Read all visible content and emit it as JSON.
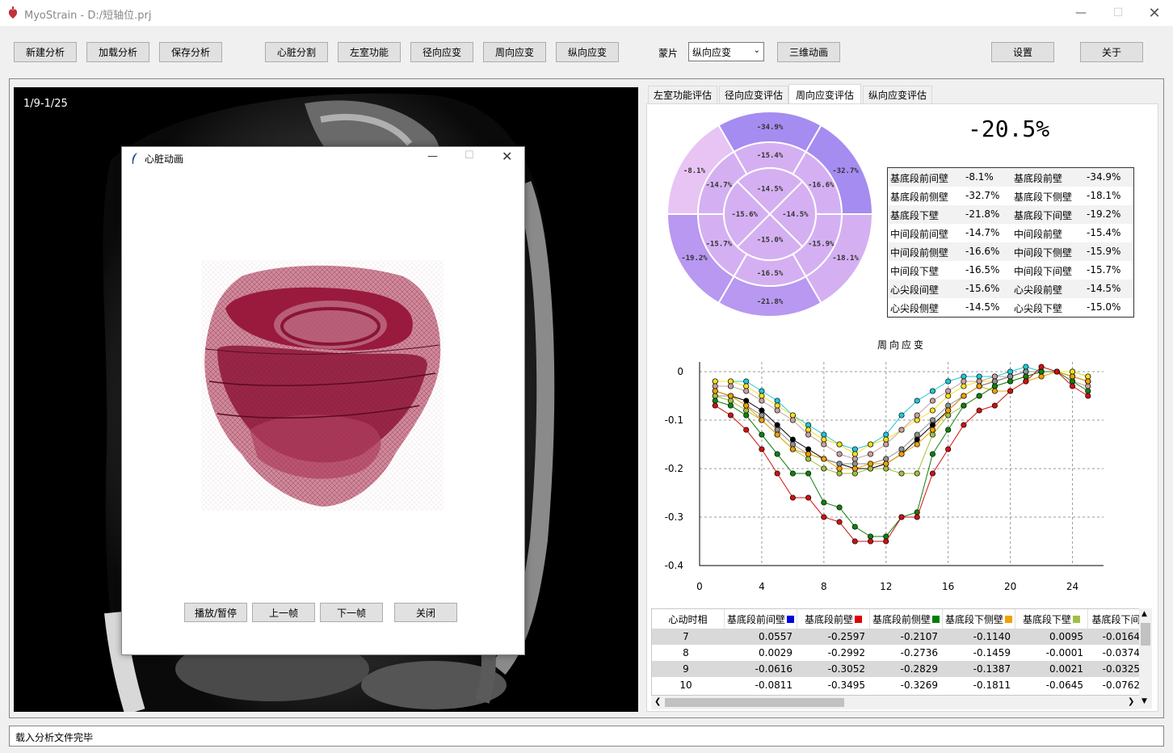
{
  "window": {
    "app_title": "MyoStrain - D:/短轴位.prj"
  },
  "toolbar": {
    "buttons": [
      "新建分析",
      "加载分析",
      "保存分析",
      "心脏分割",
      "左室功能",
      "径向应变",
      "周向应变",
      "纵向应变"
    ],
    "combo_label": "蒙片",
    "combo_value": "纵向应变",
    "anim_button": "三维动画",
    "settings_button": "设置",
    "about_button": "关于"
  },
  "viewer": {
    "frame_counter": "1/9-1/25"
  },
  "popup": {
    "title": "心脏动画",
    "buttons": [
      "播放/暂停",
      "上一帧",
      "下一帧",
      "关闭"
    ]
  },
  "tabs": [
    "左室功能评估",
    "径向应变评估",
    "周向应变评估",
    "纵向应变评估"
  ],
  "active_tab": 2,
  "global_strain": "-20.5%",
  "bullseye": {
    "outer": [
      "-34.9%",
      "-32.7%",
      "-18.1%",
      "-21.8%",
      "-19.2%",
      "-8.1%"
    ],
    "middle": [
      "-15.4%",
      "-16.6%",
      "-15.9%",
      "-16.5%",
      "-15.7%",
      "-14.7%"
    ],
    "inner": [
      "-14.5%",
      "-14.5%",
      "-15.0%",
      "-15.6%"
    ],
    "colors": {
      "light": "#e8c4f5",
      "mid": "#d4b0f2",
      "strong": "#b898f0",
      "strongest": "#a58cf0",
      "border": "#ffffff"
    }
  },
  "segment_table": [
    [
      "基底段前间壁",
      "-8.1%",
      "基底段前壁",
      "-34.9%"
    ],
    [
      "基底段前侧壁",
      "-32.7%",
      "基底段下侧壁",
      "-18.1%"
    ],
    [
      "基底段下壁",
      "-21.8%",
      "基底段下间壁",
      "-19.2%"
    ],
    [
      "中间段前间壁",
      "-14.7%",
      "中间段前壁",
      "-15.4%"
    ],
    [
      "中间段前侧壁",
      "-16.6%",
      "中间段下侧壁",
      "-15.9%"
    ],
    [
      "中间段下壁",
      "-16.5%",
      "中间段下间壁",
      "-15.7%"
    ],
    [
      "心尖段间壁",
      "-15.6%",
      "心尖段前壁",
      "-14.5%"
    ],
    [
      "心尖段侧壁",
      "-14.5%",
      "心尖段下壁",
      "-15.0%"
    ]
  ],
  "chart_data": {
    "type": "line",
    "title": "周向应变",
    "xlim": [
      0,
      26
    ],
    "ylim": [
      -0.4,
      0.02
    ],
    "x_ticks": [
      "0",
      "4",
      "8",
      "12",
      "16",
      "20",
      "24"
    ],
    "y_ticks": [
      "0",
      "-0.1",
      "-0.2",
      "-0.3",
      "-0.4"
    ],
    "grid": true,
    "x": [
      1,
      2,
      3,
      4,
      5,
      6,
      7,
      8,
      9,
      10,
      11,
      12,
      13,
      14,
      15,
      16,
      17,
      18,
      19,
      20,
      21,
      22,
      23,
      24,
      25
    ],
    "series": [
      {
        "color": "#1ec8d8",
        "values": [
          -0.02,
          -0.02,
          -0.02,
          -0.04,
          -0.06,
          -0.09,
          -0.11,
          -0.13,
          -0.15,
          -0.16,
          -0.15,
          -0.13,
          -0.09,
          -0.06,
          -0.04,
          -0.02,
          -0.01,
          -0.01,
          -0.01,
          0.0,
          0.01,
          0.0,
          0.0,
          0.0,
          -0.01
        ]
      },
      {
        "color": "#f5e020",
        "values": [
          -0.02,
          -0.02,
          -0.03,
          -0.05,
          -0.07,
          -0.09,
          -0.12,
          -0.14,
          -0.15,
          -0.17,
          -0.15,
          -0.14,
          -0.12,
          -0.1,
          -0.08,
          -0.05,
          -0.03,
          -0.02,
          -0.02,
          -0.01,
          0.0,
          0.0,
          0.0,
          0.0,
          -0.01
        ]
      },
      {
        "color": "#c8a0a0",
        "values": [
          -0.03,
          -0.03,
          -0.04,
          -0.06,
          -0.08,
          -0.1,
          -0.13,
          -0.15,
          -0.17,
          -0.18,
          -0.17,
          -0.15,
          -0.12,
          -0.09,
          -0.06,
          -0.04,
          -0.02,
          -0.02,
          -0.01,
          -0.01,
          0.0,
          0.0,
          0.0,
          -0.02,
          -0.03
        ]
      },
      {
        "color": "#000000",
        "values": [
          -0.04,
          -0.05,
          -0.06,
          -0.08,
          -0.11,
          -0.14,
          -0.16,
          -0.18,
          -0.19,
          -0.2,
          -0.2,
          -0.19,
          -0.17,
          -0.14,
          -0.11,
          -0.08,
          -0.05,
          -0.03,
          -0.02,
          -0.01,
          0.0,
          0.0,
          0.0,
          -0.01,
          -0.02
        ]
      },
      {
        "color": "#909090",
        "values": [
          -0.05,
          -0.05,
          -0.07,
          -0.09,
          -0.12,
          -0.15,
          -0.17,
          -0.18,
          -0.19,
          -0.19,
          -0.19,
          -0.18,
          -0.16,
          -0.13,
          -0.1,
          -0.07,
          -0.05,
          -0.03,
          -0.02,
          -0.01,
          0.0,
          0.0,
          0.0,
          -0.01,
          -0.02
        ]
      },
      {
        "color": "#a0c040",
        "values": [
          -0.05,
          -0.06,
          -0.08,
          -0.1,
          -0.13,
          -0.16,
          -0.18,
          -0.2,
          -0.21,
          -0.21,
          -0.2,
          -0.2,
          -0.21,
          -0.21,
          -0.13,
          -0.09,
          -0.07,
          -0.05,
          -0.03,
          -0.02,
          -0.01,
          0.0,
          0.0,
          -0.01,
          -0.02
        ]
      },
      {
        "color": "#f0a000",
        "values": [
          -0.04,
          -0.05,
          -0.07,
          -0.1,
          -0.13,
          -0.16,
          -0.17,
          -0.18,
          -0.2,
          -0.2,
          -0.19,
          -0.19,
          -0.17,
          -0.15,
          -0.12,
          -0.08,
          -0.05,
          -0.03,
          -0.04,
          -0.04,
          -0.02,
          -0.01,
          0.0,
          -0.01,
          -0.02
        ]
      },
      {
        "color": "#108010",
        "values": [
          -0.06,
          -0.07,
          -0.09,
          -0.13,
          -0.17,
          -0.21,
          -0.21,
          -0.27,
          -0.28,
          -0.32,
          -0.34,
          -0.34,
          -0.3,
          -0.29,
          -0.17,
          -0.12,
          -0.07,
          -0.05,
          -0.03,
          -0.02,
          -0.01,
          0.0,
          0.0,
          -0.02,
          -0.04
        ]
      },
      {
        "color": "#d01010",
        "values": [
          -0.07,
          -0.09,
          -0.12,
          -0.16,
          -0.21,
          -0.26,
          -0.26,
          -0.3,
          -0.31,
          -0.35,
          -0.35,
          -0.35,
          -0.3,
          -0.3,
          -0.21,
          -0.16,
          -0.11,
          -0.08,
          -0.07,
          -0.04,
          -0.02,
          0.01,
          0.0,
          -0.03,
          -0.05
        ]
      }
    ]
  },
  "data_grid": {
    "headers": [
      "心动时相",
      "基底段前间壁",
      "基底段前壁",
      "基底段前侧壁",
      "基底段下侧壁",
      "基底段下壁",
      "基底段下间"
    ],
    "header_colors": [
      "",
      "#0000e0",
      "#e00000",
      "#008000",
      "#f0a000",
      "#a0c040"
    ],
    "rows": [
      [
        "7",
        "0.0557",
        "-0.2597",
        "-0.2107",
        "-0.1140",
        "0.0095",
        "-0.0164"
      ],
      [
        "8",
        "0.0029",
        "-0.2992",
        "-0.2736",
        "-0.1459",
        "-0.0001",
        "-0.0374"
      ],
      [
        "9",
        "-0.0616",
        "-0.3052",
        "-0.2829",
        "-0.1387",
        "0.0021",
        "-0.0325"
      ],
      [
        "10",
        "-0.0811",
        "-0.3495",
        "-0.3269",
        "-0.1811",
        "-0.0645",
        "-0.0762"
      ]
    ]
  },
  "status": "载入分析文件完毕"
}
